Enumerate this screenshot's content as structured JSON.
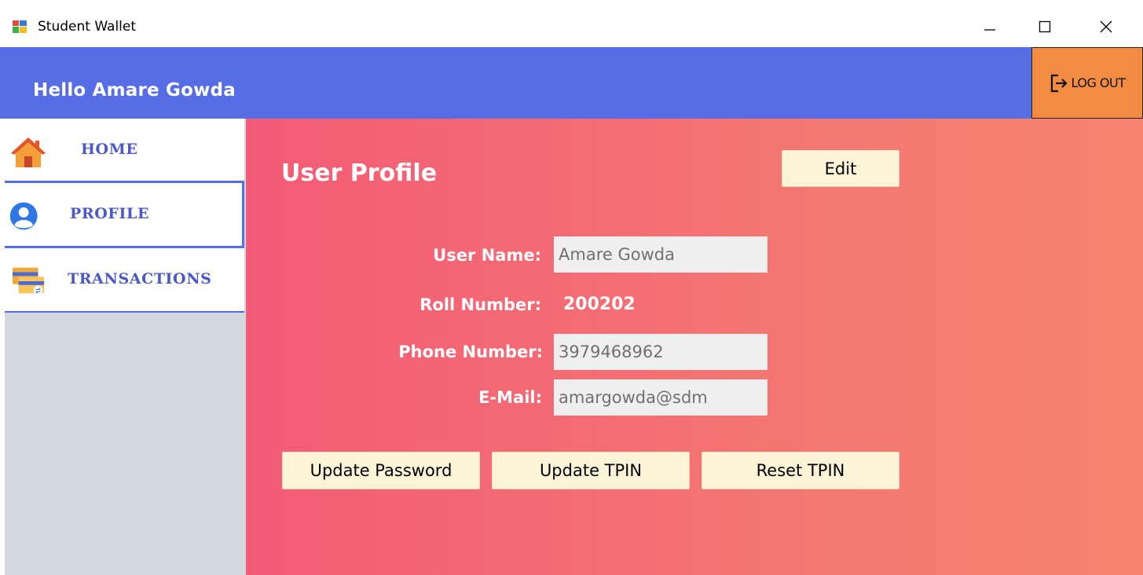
{
  "window": {
    "title": "Student Wallet",
    "app_icon": "window-app-icon",
    "controls": [
      "minimize-icon",
      "maximize-icon",
      "close-icon"
    ]
  },
  "header": {
    "greeting": "Hello Amare Gowda",
    "logout_label": "LOG OUT",
    "logout_icon": "logout-icon",
    "color": "#566de6",
    "logout_color": "#f38c43"
  },
  "sidebar": {
    "items": [
      {
        "label": "HOME",
        "icon": "home-icon"
      },
      {
        "label": "PROFILE",
        "icon": "user-icon"
      },
      {
        "label": "TRANSACTIONS",
        "icon": "card-icon"
      }
    ],
    "label_color": "#4a58c8"
  },
  "main": {
    "title": "User Profile",
    "edit_label": "Edit",
    "fields": {
      "username_label": "User Name:",
      "username_value": "Amare Gowda",
      "roll_label": "Roll Number:",
      "roll_value": "200202",
      "phone_label": "Phone Number:",
      "phone_value": "3979468962",
      "email_label": "E-Mail:",
      "email_value": "amargowda@sdm"
    },
    "buttons": {
      "update_password": "Update Password",
      "update_tpin": "Update TPIN",
      "reset_tpin": "Reset TPIN"
    },
    "gradient": [
      "#f35b76",
      "#f6836f"
    ],
    "button_color": "#fdf3d7"
  }
}
